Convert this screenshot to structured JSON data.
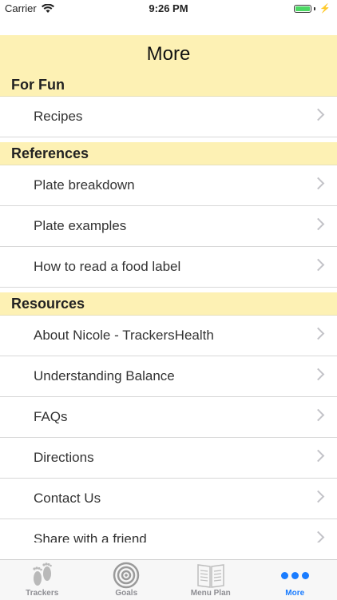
{
  "status_bar": {
    "carrier": "Carrier",
    "time": "9:26 PM"
  },
  "header": {
    "title": "More"
  },
  "sections": [
    {
      "title": "For Fun",
      "items": [
        "Recipes"
      ]
    },
    {
      "title": "References",
      "items": [
        "Plate breakdown",
        "Plate examples",
        "How to read a food label"
      ]
    },
    {
      "title": "Resources",
      "items": [
        "About Nicole - TrackersHealth",
        "Understanding Balance",
        "FAQs",
        "Directions",
        "Contact Us",
        "Share with a friend"
      ]
    }
  ],
  "tab_bar": {
    "tabs": [
      {
        "label": "Trackers",
        "icon": "footprints-icon",
        "active": false
      },
      {
        "label": "Goals",
        "icon": "target-icon",
        "active": false
      },
      {
        "label": "Menu Plan",
        "icon": "book-icon",
        "active": false
      },
      {
        "label": "More",
        "icon": "more-dots-icon",
        "active": true
      }
    ]
  },
  "colors": {
    "header_bg": "#fdf1b4",
    "active_tab": "#1a7cff",
    "inactive_tab": "#8e8e93"
  }
}
